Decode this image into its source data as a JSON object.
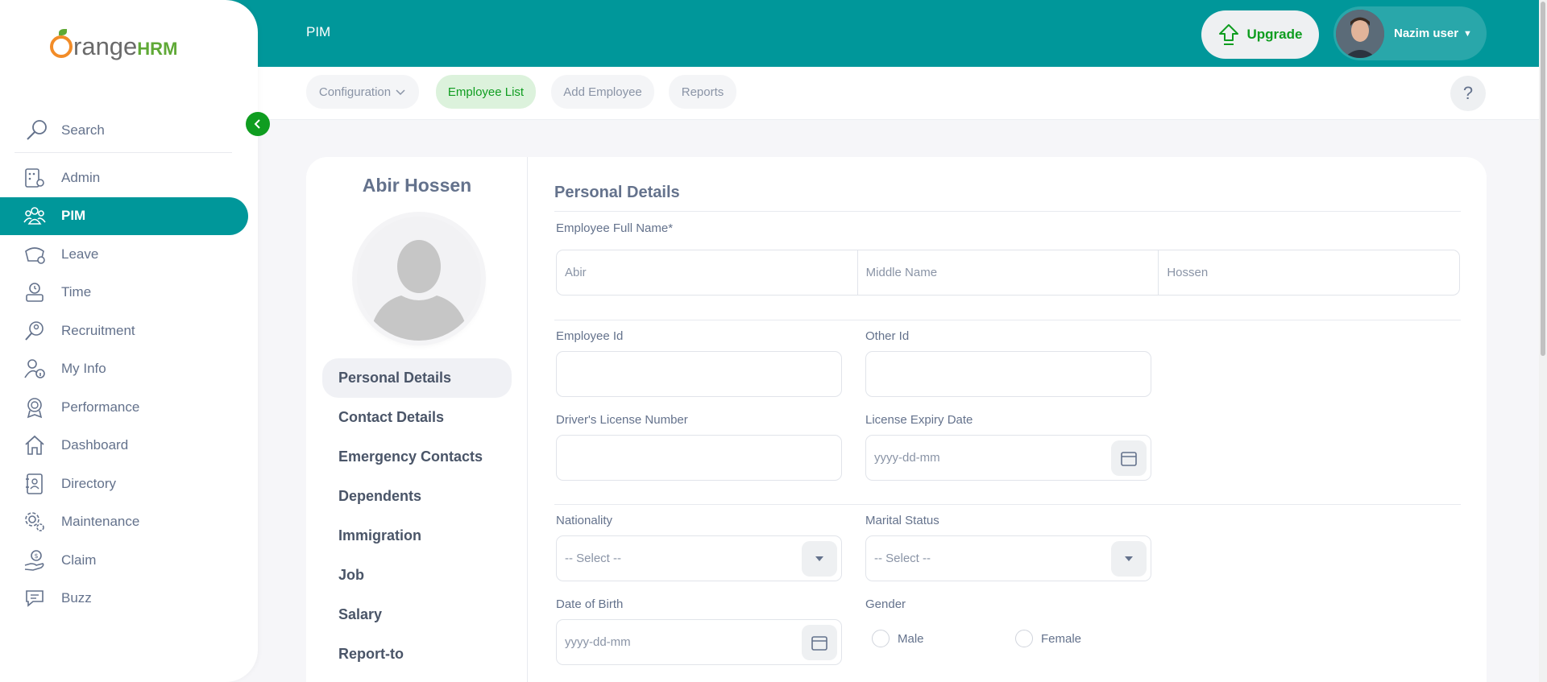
{
  "logo": {
    "part1": "range",
    "part2": "HRM"
  },
  "sidebar": {
    "search_label": "Search",
    "items": [
      {
        "label": "Admin",
        "icon": "admin-icon"
      },
      {
        "label": "PIM",
        "icon": "pim-icon",
        "active": true
      },
      {
        "label": "Leave",
        "icon": "leave-icon"
      },
      {
        "label": "Time",
        "icon": "time-icon"
      },
      {
        "label": "Recruitment",
        "icon": "recruitment-icon"
      },
      {
        "label": "My Info",
        "icon": "my-info-icon"
      },
      {
        "label": "Performance",
        "icon": "performance-icon"
      },
      {
        "label": "Dashboard",
        "icon": "dashboard-icon"
      },
      {
        "label": "Directory",
        "icon": "directory-icon"
      },
      {
        "label": "Maintenance",
        "icon": "maintenance-icon"
      },
      {
        "label": "Claim",
        "icon": "claim-icon"
      },
      {
        "label": "Buzz",
        "icon": "buzz-icon"
      }
    ]
  },
  "topbar": {
    "title": "PIM",
    "upgrade_label": "Upgrade",
    "user_name": "Nazim user"
  },
  "subnav": {
    "tabs": [
      {
        "label": "Configuration"
      },
      {
        "label": "Employee List",
        "active": true
      },
      {
        "label": "Add Employee"
      },
      {
        "label": "Reports"
      }
    ],
    "help_label": "?"
  },
  "employee": {
    "name": "Abir Hossen"
  },
  "side_menu": {
    "items": [
      {
        "label": "Personal Details",
        "active": true
      },
      {
        "label": "Contact Details"
      },
      {
        "label": "Emergency Contacts"
      },
      {
        "label": "Dependents"
      },
      {
        "label": "Immigration"
      },
      {
        "label": "Job"
      },
      {
        "label": "Salary"
      },
      {
        "label": "Report-to"
      }
    ]
  },
  "form": {
    "title": "Personal Details",
    "full_name_label": "Employee Full Name*",
    "first_name": "Abir",
    "middle_name_placeholder": "Middle Name",
    "last_name": "Hossen",
    "employee_id_label": "Employee Id",
    "other_id_label": "Other Id",
    "license_label": "Driver's License Number",
    "license_expiry_label": "License Expiry Date",
    "license_expiry_placeholder": "yyyy-dd-mm",
    "nationality_label": "Nationality",
    "nationality_value": "-- Select --",
    "marital_label": "Marital Status",
    "marital_value": "-- Select --",
    "dob_label": "Date of Birth",
    "dob_placeholder": "yyyy-dd-mm",
    "gender_label": "Gender",
    "gender_options": [
      "Male",
      "Female"
    ]
  },
  "colors": {
    "brand": "#00979a",
    "accent_green": "#0f9d20"
  }
}
